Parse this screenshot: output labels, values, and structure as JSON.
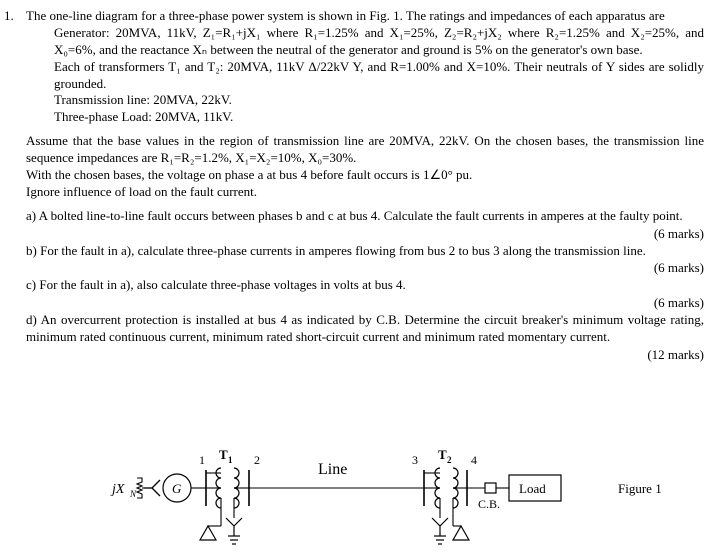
{
  "question": {
    "number": "1.",
    "intro": "The one-line diagram for a three-phase power system is shown in Fig. 1. The ratings and impedances of each apparatus are",
    "generator": "Generator: 20MVA, 11kV, Z₁=R₁+jX₁ where R₁=1.25% and X₁=25%, Z₂=R₂+jX₂ where R₂=1.25% and X₂=25%, and X₀=6%, and the reactance Xₙ between the neutral of the generator and ground is 5% on the generator's own base.",
    "transformers": "Each of transformers T₁ and T₂: 20MVA, 11kV Δ/22kV Y, and R=1.00% and X=10%. Their neutrals of Y sides are solidly grounded.",
    "transmission": "Transmission line: 20MVA, 22kV.",
    "load": "Three-phase Load: 20MVA, 11kV.",
    "assume": "Assume that the base values in the region of transmission line are 20MVA, 22kV. On the chosen bases, the transmission line sequence impedances are R₁=R₂=1.2%, X₁=X₂=10%, X₀=30%.",
    "voltage_note": "With the chosen bases, the voltage on phase a at bus 4 before fault occurs is 1∠0° pu.",
    "ignore_note": "Ignore influence of load on the fault current.",
    "parts": [
      {
        "label": "a)",
        "text": "A bolted line-to-line fault occurs between phases b and c at bus 4. Calculate the fault currents in amperes at the faulty point.",
        "marks": "(6 marks)"
      },
      {
        "label": "b)",
        "text": "For the fault in a), calculate three-phase currents in amperes flowing from bus 2 to bus 3 along the transmission line.",
        "marks": "(6 marks)"
      },
      {
        "label": "c)",
        "text": "For the fault in a), also calculate three-phase voltages in volts at bus 4.",
        "marks": "(6 marks)"
      },
      {
        "label": "d)",
        "text": "An overcurrent protection is installed at bus 4 as indicated by C.B. Determine the circuit breaker's minimum voltage rating, minimum rated continuous current, minimum rated short-circuit current and minimum rated momentary current.",
        "marks": "(12 marks)"
      }
    ]
  },
  "figure": {
    "caption": "Figure 1",
    "generator_label": "G",
    "reactance_label": "jX",
    "reactance_sub": "N",
    "bus1": "1",
    "bus2": "2",
    "bus3": "3",
    "bus4": "4",
    "t1": "T",
    "t1_sub": "1",
    "t2": "T",
    "t2_sub": "2",
    "line": "Line",
    "cb": "C.B.",
    "load": "Load"
  }
}
